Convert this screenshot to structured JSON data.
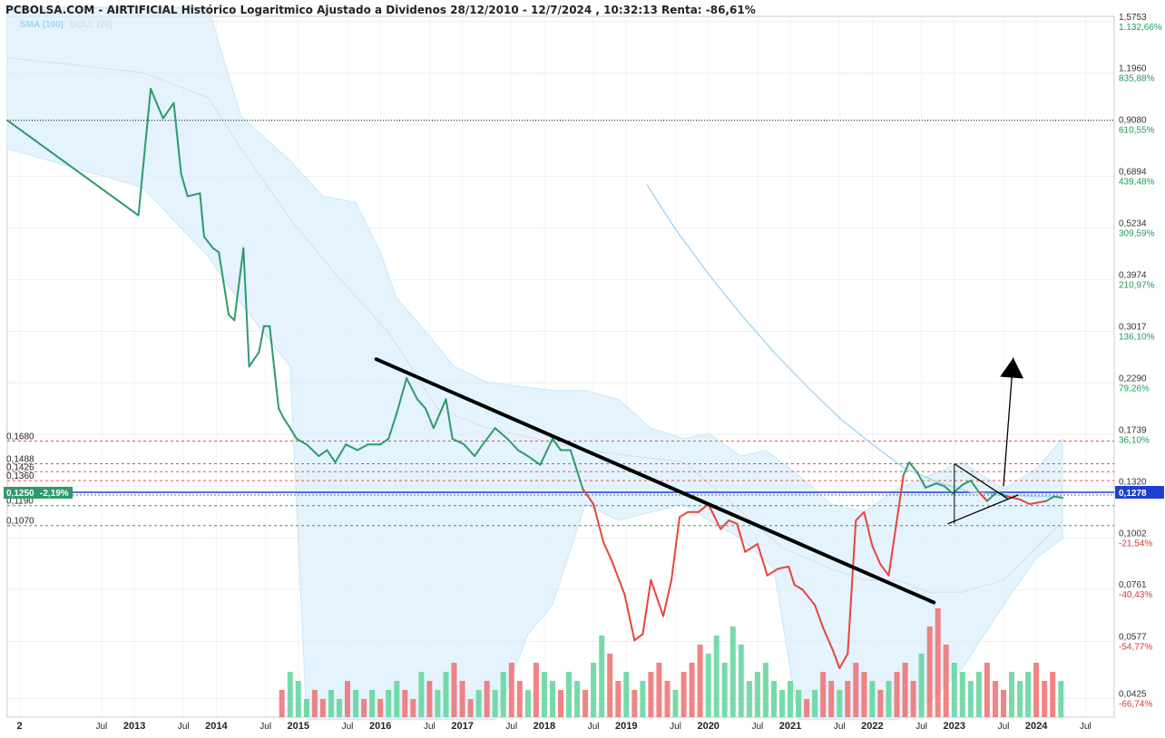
{
  "header": {
    "title": "PCBOLSA.COM - AIRTIFICIAL Histórico Logaritmico Ajustado a Dividenos 28/12/2010 - 12/7/2024 , 10:32:13 Renta: -86,61%",
    "legend_sma": "SMA (100)",
    "legend_boll": "BOLL (20)"
  },
  "chart_data": {
    "type": "line",
    "yscale": "log",
    "ylim": [
      0.0385,
      1.62
    ],
    "xlim": [
      2012.35,
      2025.85
    ],
    "legend_placement": "top-left",
    "grid": true,
    "x_ticks": [
      {
        "x": 2012.5,
        "label": "2"
      },
      {
        "x": 2013.5,
        "label": "Jul"
      },
      {
        "x": 2013.9,
        "label": "2013"
      },
      {
        "x": 2014.5,
        "label": "Jul"
      },
      {
        "x": 2014.9,
        "label": "2014"
      },
      {
        "x": 2015.5,
        "label": "Jul"
      },
      {
        "x": 2015.9,
        "label": "2015"
      },
      {
        "x": 2016.5,
        "label": "Jul"
      },
      {
        "x": 2016.9,
        "label": "2016"
      },
      {
        "x": 2017.5,
        "label": "Jul"
      },
      {
        "x": 2017.9,
        "label": "2017"
      },
      {
        "x": 2018.5,
        "label": "Jul"
      },
      {
        "x": 2018.9,
        "label": "2018"
      },
      {
        "x": 2019.5,
        "label": "Jul"
      },
      {
        "x": 2019.9,
        "label": "2019"
      },
      {
        "x": 2020.5,
        "label": "Jul"
      },
      {
        "x": 2020.9,
        "label": "2020"
      },
      {
        "x": 2021.5,
        "label": "Jul"
      },
      {
        "x": 2021.9,
        "label": "2021"
      },
      {
        "x": 2022.5,
        "label": "Jul"
      },
      {
        "x": 2022.9,
        "label": "2022"
      },
      {
        "x": 2023.5,
        "label": "Jul"
      },
      {
        "x": 2023.9,
        "label": "2023"
      },
      {
        "x": 2024.5,
        "label": "Jul"
      },
      {
        "x": 2024.9,
        "label": "2024"
      },
      {
        "x": 2025.5,
        "label": "Jul"
      }
    ],
    "y_ticks": [
      {
        "value": 1.5753,
        "label": "1,5753",
        "pct": "1.132,66%"
      },
      {
        "value": 1.196,
        "label": "1,1960",
        "pct": "835,88%"
      },
      {
        "value": 0.908,
        "label": "0,9080",
        "pct": "610,55%"
      },
      {
        "value": 0.6894,
        "label": "0,6894",
        "pct": "439,48%"
      },
      {
        "value": 0.5234,
        "label": "0,5234",
        "pct": "309,59%"
      },
      {
        "value": 0.3974,
        "label": "0,3974",
        "pct": "210,97%"
      },
      {
        "value": 0.3017,
        "label": "0,3017",
        "pct": "136,10%"
      },
      {
        "value": 0.229,
        "label": "0,2290",
        "pct": "79,26%"
      },
      {
        "value": 0.1739,
        "label": "0,1739",
        "pct": "36,10%"
      },
      {
        "value": 0.132,
        "label": "0,1320",
        "pct": ""
      },
      {
        "value": 0.1002,
        "label": "0,1002",
        "pct": "-21,54%"
      },
      {
        "value": 0.0761,
        "label": "0,0761",
        "pct": "-40,43%"
      },
      {
        "value": 0.0577,
        "label": "0,0577",
        "pct": "-54,77%"
      },
      {
        "value": 0.0425,
        "label": "0,0425",
        "pct": "-66,74%"
      }
    ],
    "base_price": 0.1278,
    "last_price_label": "0,1278",
    "current_label": "0,1250",
    "current_change": "-2,19%",
    "high_line": 0.93,
    "levels": [
      {
        "value": 0.168,
        "label": "0,1680"
      },
      {
        "value": 0.1488,
        "label": "0,1488"
      },
      {
        "value": 0.1426,
        "label": "0,1426"
      },
      {
        "value": 0.136,
        "label": "0,1360"
      },
      {
        "value": 0.119,
        "label": "0,1190"
      },
      {
        "value": 0.107,
        "label": "0,1070"
      }
    ],
    "price_series": {
      "name": "",
      "x": [
        2012.35,
        2013.95,
        2014.1,
        2014.25,
        2014.38,
        2014.47,
        2014.55,
        2014.7,
        2014.75,
        2014.86,
        2014.93,
        2015.05,
        2015.12,
        2015.23,
        2015.3,
        2015.42,
        2015.48,
        2015.55,
        2015.66,
        2015.72,
        2015.8,
        2015.88,
        2016.0,
        2016.15,
        2016.25,
        2016.35,
        2016.48,
        2016.62,
        2016.75,
        2016.9,
        2017.0,
        2017.1,
        2017.22,
        2017.35,
        2017.45,
        2017.55,
        2017.7,
        2017.78,
        2017.92,
        2018.05,
        2018.15,
        2018.3,
        2018.45,
        2018.58,
        2018.7,
        2018.85,
        2019.0,
        2019.1,
        2019.22,
        2019.37,
        2019.5,
        2019.62,
        2019.72,
        2019.88,
        2020.0,
        2020.1,
        2020.2,
        2020.35,
        2020.45,
        2020.55,
        2020.65,
        2020.78,
        2020.9,
        2021.05,
        2021.15,
        2021.25,
        2021.35,
        2021.5,
        2021.62,
        2021.75,
        2021.88,
        2021.95,
        2022.05,
        2022.2,
        2022.3,
        2022.42,
        2022.5,
        2022.6,
        2022.7,
        2022.8,
        2022.9,
        2023.0,
        2023.1,
        2023.2,
        2023.28,
        2023.35,
        2023.45,
        2023.55,
        2023.68,
        2023.78,
        2023.88,
        2024.0,
        2024.1,
        2024.2,
        2024.3,
        2024.42,
        2024.55,
        2024.7,
        2024.82,
        2024.92,
        2025.02,
        2025.12,
        2025.22
      ],
      "values": [
        0.93,
        0.56,
        1.1,
        0.94,
        1.02,
        0.7,
        0.62,
        0.63,
        0.5,
        0.47,
        0.46,
        0.33,
        0.32,
        0.47,
        0.25,
        0.27,
        0.31,
        0.31,
        0.2,
        0.19,
        0.18,
        0.17,
        0.165,
        0.155,
        0.16,
        0.15,
        0.165,
        0.16,
        0.165,
        0.165,
        0.17,
        0.195,
        0.235,
        0.21,
        0.2,
        0.18,
        0.21,
        0.17,
        0.165,
        0.155,
        0.165,
        0.18,
        0.17,
        0.16,
        0.155,
        0.148,
        0.17,
        0.16,
        0.16,
        0.13,
        0.12,
        0.098,
        0.089,
        0.074,
        0.058,
        0.06,
        0.08,
        0.066,
        0.08,
        0.112,
        0.115,
        0.115,
        0.12,
        0.105,
        0.11,
        0.108,
        0.093,
        0.097,
        0.082,
        0.085,
        0.086,
        0.078,
        0.076,
        0.07,
        0.062,
        0.055,
        0.05,
        0.054,
        0.11,
        0.115,
        0.096,
        0.087,
        0.082,
        0.11,
        0.14,
        0.15,
        0.142,
        0.131,
        0.134,
        0.132,
        0.127,
        0.133,
        0.136,
        0.128,
        0.122,
        0.128,
        0.125,
        0.123,
        0.12,
        0.121,
        0.122,
        0.125,
        0.124
      ]
    },
    "sma_series": {
      "name": "",
      "x": [
        2020.15,
        2020.5,
        2020.9,
        2021.3,
        2021.7,
        2022.1,
        2022.5,
        2022.9,
        2023.3,
        2023.7,
        2024.1,
        2024.5,
        2024.9,
        2025.2
      ],
      "values": [
        0.66,
        0.52,
        0.41,
        0.33,
        0.27,
        0.225,
        0.19,
        0.165,
        0.145,
        0.135,
        0.128,
        0.126,
        0.125,
        0.125
      ]
    },
    "boll_upper": {
      "x": [
        2012.35,
        2014.0,
        2014.8,
        2015.2,
        2015.8,
        2016.2,
        2016.6,
        2016.9,
        2017.1,
        2017.4,
        2017.8,
        2018.2,
        2018.6,
        2019.0,
        2019.4,
        2019.8,
        2020.2,
        2020.6,
        2020.9,
        2021.3,
        2021.6,
        2022.0,
        2022.4,
        2022.8,
        2023.2,
        2023.6,
        2024.0,
        2024.5,
        2024.9,
        2025.22
      ],
      "values": [
        1.7,
        1.7,
        1.7,
        0.95,
        0.75,
        0.62,
        0.6,
        0.46,
        0.36,
        0.31,
        0.25,
        0.23,
        0.225,
        0.22,
        0.22,
        0.21,
        0.18,
        0.17,
        0.175,
        0.155,
        0.16,
        0.14,
        0.12,
        0.115,
        0.13,
        0.14,
        0.15,
        0.13,
        0.145,
        0.17
      ]
    },
    "boll_lower": {
      "x": [
        2012.35,
        2014.0,
        2014.8,
        2015.2,
        2015.8,
        2016.0,
        2016.4,
        2016.9,
        2017.1,
        2017.5,
        2017.9,
        2018.3,
        2018.7,
        2019.0,
        2019.4,
        2019.8,
        2020.2,
        2020.6,
        2020.9,
        2021.3,
        2021.7,
        2022.0,
        2022.4,
        2022.8,
        2023.2,
        2023.6,
        2024.0,
        2024.5,
        2024.9,
        2025.22
      ],
      "values": [
        0.8,
        0.65,
        0.45,
        0.35,
        0.25,
        0.038,
        0.038,
        0.038,
        0.038,
        0.038,
        0.038,
        0.038,
        0.06,
        0.07,
        0.12,
        0.11,
        0.115,
        0.12,
        0.11,
        0.1,
        0.085,
        0.038,
        0.038,
        0.038,
        0.038,
        0.042,
        0.05,
        0.07,
        0.09,
        0.1
      ]
    },
    "boll_middle": {
      "x": [
        2012.35,
        2014.0,
        2014.8,
        2015.2,
        2015.8,
        2016.4,
        2017.0,
        2017.6,
        2018.2,
        2018.8,
        2019.4,
        2020.0,
        2020.6,
        2021.2,
        2021.8,
        2022.4,
        2022.8,
        2023.2,
        2023.6,
        2024.0,
        2024.5,
        2024.9,
        2025.22
      ],
      "values": [
        1.3,
        1.2,
        1.05,
        0.8,
        0.55,
        0.4,
        0.3,
        0.2,
        0.18,
        0.17,
        0.16,
        0.155,
        0.15,
        0.12,
        0.095,
        0.085,
        0.08,
        0.08,
        0.075,
        0.075,
        0.08,
        0.095,
        0.11
      ]
    },
    "volume": {
      "x": [
        2015.7,
        2015.8,
        2015.9,
        2016.0,
        2016.1,
        2016.2,
        2016.3,
        2016.4,
        2016.5,
        2016.6,
        2016.7,
        2016.8,
        2016.9,
        2017.0,
        2017.1,
        2017.2,
        2017.3,
        2017.4,
        2017.5,
        2017.6,
        2017.7,
        2017.8,
        2017.9,
        2018.0,
        2018.1,
        2018.2,
        2018.3,
        2018.4,
        2018.5,
        2018.6,
        2018.7,
        2018.8,
        2018.9,
        2019.0,
        2019.1,
        2019.2,
        2019.3,
        2019.4,
        2019.5,
        2019.6,
        2019.7,
        2019.8,
        2019.9,
        2020.0,
        2020.1,
        2020.2,
        2020.3,
        2020.4,
        2020.5,
        2020.6,
        2020.7,
        2020.8,
        2020.9,
        2021.0,
        2021.1,
        2021.2,
        2021.3,
        2021.4,
        2021.5,
        2021.6,
        2021.7,
        2021.8,
        2021.9,
        2022.0,
        2022.1,
        2022.2,
        2022.3,
        2022.4,
        2022.5,
        2022.6,
        2022.7,
        2022.8,
        2022.9,
        2023.0,
        2023.1,
        2023.2,
        2023.3,
        2023.4,
        2023.5,
        2023.6,
        2023.7,
        2023.8,
        2023.9,
        2024.0,
        2024.1,
        2024.2,
        2024.3,
        2024.4,
        2024.5,
        2024.6,
        2024.7,
        2024.8,
        2024.9,
        2025.0,
        2025.1,
        2025.2
      ],
      "values": [
        3,
        5,
        4,
        2,
        3,
        2,
        3,
        2,
        4,
        3,
        2,
        3,
        2,
        3,
        4,
        3,
        2,
        5,
        4,
        3,
        5,
        6,
        4,
        2,
        3,
        4,
        3,
        5,
        6,
        4,
        3,
        6,
        5,
        4,
        3,
        5,
        4,
        3,
        6,
        9,
        7,
        4,
        5,
        3,
        4,
        5,
        6,
        4,
        3,
        5,
        6,
        8,
        7,
        9,
        6,
        10,
        8,
        4,
        5,
        6,
        4,
        3,
        4,
        3,
        2,
        3,
        5,
        4,
        3,
        4,
        6,
        5,
        4,
        3,
        4,
        5,
        6,
        4,
        7,
        10,
        12,
        8,
        6,
        5,
        4,
        5,
        6,
        4,
        3,
        5,
        4,
        5,
        6,
        4,
        5,
        4
      ],
      "directions": [
        "d",
        "u",
        "u",
        "u",
        "d",
        "d",
        "u",
        "u",
        "d",
        "u",
        "d",
        "u",
        "d",
        "u",
        "u",
        "d",
        "d",
        "u",
        "d",
        "u",
        "u",
        "d",
        "d",
        "d",
        "u",
        "d",
        "u",
        "u",
        "d",
        "d",
        "u",
        "d",
        "u",
        "u",
        "d",
        "u",
        "u",
        "d",
        "u",
        "u",
        "d",
        "d",
        "u",
        "d",
        "u",
        "d",
        "d",
        "d",
        "u",
        "d",
        "d",
        "d",
        "u",
        "u",
        "u",
        "u",
        "u",
        "u",
        "u",
        "u",
        "u",
        "u",
        "u",
        "u",
        "d",
        "u",
        "d",
        "d",
        "u",
        "d",
        "d",
        "d",
        "u",
        "d",
        "u",
        "d",
        "d",
        "d",
        "u",
        "d",
        "d",
        "d",
        "u",
        "u",
        "u",
        "u",
        "d",
        "d",
        "d",
        "u",
        "u",
        "u",
        "d",
        "d",
        "d",
        "u"
      ]
    },
    "annotations": {
      "long_trendline": {
        "from": {
          "x": 2016.85,
          "y": 0.26
        },
        "to": {
          "x": 2023.65,
          "y": 0.071
        }
      },
      "triangle_upper": {
        "from": {
          "x": 2023.9,
          "y": 0.1488
        },
        "to": {
          "x": 2024.55,
          "y": 0.1235
        }
      },
      "triangle_lower": {
        "from": {
          "x": 2023.82,
          "y": 0.108
        },
        "to": {
          "x": 2024.68,
          "y": 0.126
        }
      },
      "triangle_vertical": {
        "x": 2023.9,
        "from": 0.108,
        "to": 0.1488
      },
      "arrow": {
        "from": {
          "x": 2024.5,
          "y": 0.132
        },
        "to": {
          "x": 2024.62,
          "y": 0.262
        }
      }
    }
  }
}
